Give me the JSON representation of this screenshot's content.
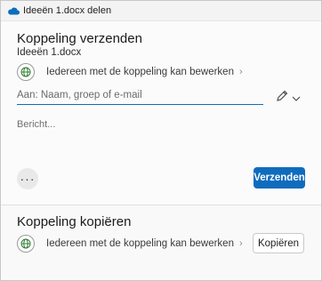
{
  "window": {
    "title": "Ideeën 1.docx delen",
    "app_icon": "onedrive-cloud-icon"
  },
  "send_section": {
    "heading": "Koppeling verzenden",
    "file_name": "Ideeën 1.docx",
    "permission_text": "Iedereen met de koppeling kan bewerken",
    "to_field": {
      "placeholder": "Aan: Naam, groep of e-mail",
      "value": ""
    },
    "message_field": {
      "placeholder": "Bericht...",
      "value": ""
    },
    "more_options_label": "···",
    "send_button_label": "Verzenden"
  },
  "copy_section": {
    "heading": "Koppeling kopiëren",
    "permission_text": "Iedereen met de koppeling kan bewerken",
    "copy_button_label": "Kopiëren"
  },
  "colors": {
    "accent": "#0f6cbd",
    "globe_icon": "#2e7d32"
  },
  "icons": [
    "globe-icon",
    "chevron-right-icon",
    "pen-icon",
    "chevron-down-icon",
    "more-icon"
  ]
}
